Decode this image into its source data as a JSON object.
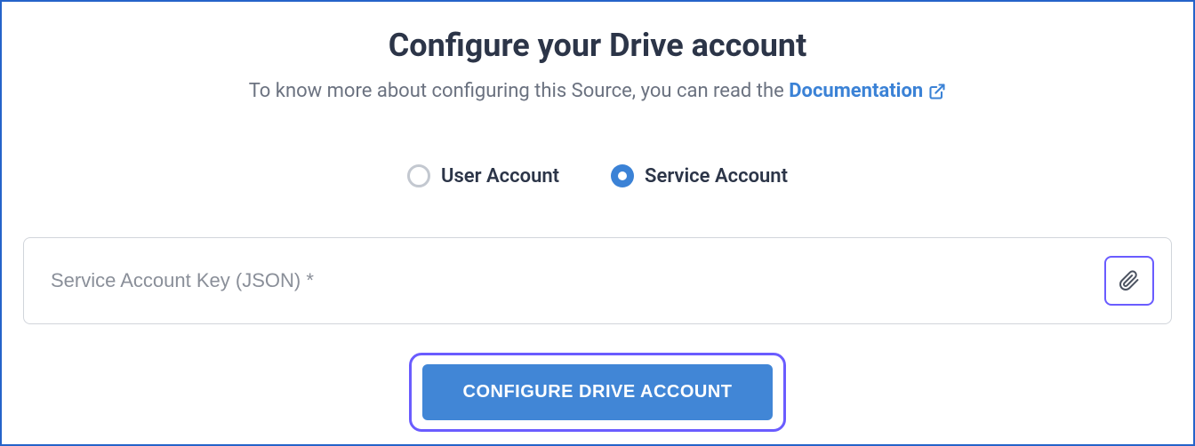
{
  "header": {
    "title": "Configure your Drive account",
    "subtitle_prefix": "To know more about configuring this Source, you can read the ",
    "doc_link_label": "Documentation"
  },
  "radio": {
    "user_account_label": "User Account",
    "service_account_label": "Service Account",
    "selected": "service"
  },
  "input": {
    "placeholder": "Service Account Key (JSON) *",
    "value": ""
  },
  "submit": {
    "label": "CONFIGURE DRIVE ACCOUNT"
  }
}
